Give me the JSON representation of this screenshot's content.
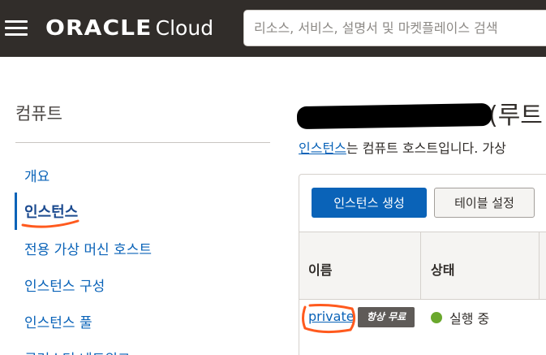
{
  "header": {
    "menu_icon": "hamburger-menu-icon",
    "logo_brand": "ORACLE",
    "logo_product": "Cloud",
    "search_placeholder": "리소스, 서비스, 설명서 및 마켓플레이스 검색"
  },
  "sidebar": {
    "title": "컴퓨트",
    "items": [
      {
        "label": "개요",
        "active": false
      },
      {
        "label": "인스턴스",
        "active": true
      },
      {
        "label": "전용 가상 머신 호스트",
        "active": false
      },
      {
        "label": "인스턴스 구성",
        "active": false
      },
      {
        "label": "인스턴스 풀",
        "active": false
      },
      {
        "label": "클러스터 네트워크",
        "active": false
      }
    ]
  },
  "main": {
    "title_suffix": "(루트",
    "description_link": "인스턴스",
    "description_rest": "는 컴퓨트 호스트입니다. 가상",
    "toolbar": {
      "create_label": "인스턴스 생성",
      "table_settings_label": "테이블 설정"
    },
    "table": {
      "columns": [
        "이름",
        "상태"
      ],
      "rows": [
        {
          "name": "private",
          "badge": "항상 무료",
          "status": "실행 중"
        }
      ]
    }
  },
  "colors": {
    "header_bg": "#312d2a",
    "link": "#0a63b8",
    "primary_button": "#0a63b8",
    "status_running": "#6aa82d",
    "annotation": "#ff5a1e"
  }
}
